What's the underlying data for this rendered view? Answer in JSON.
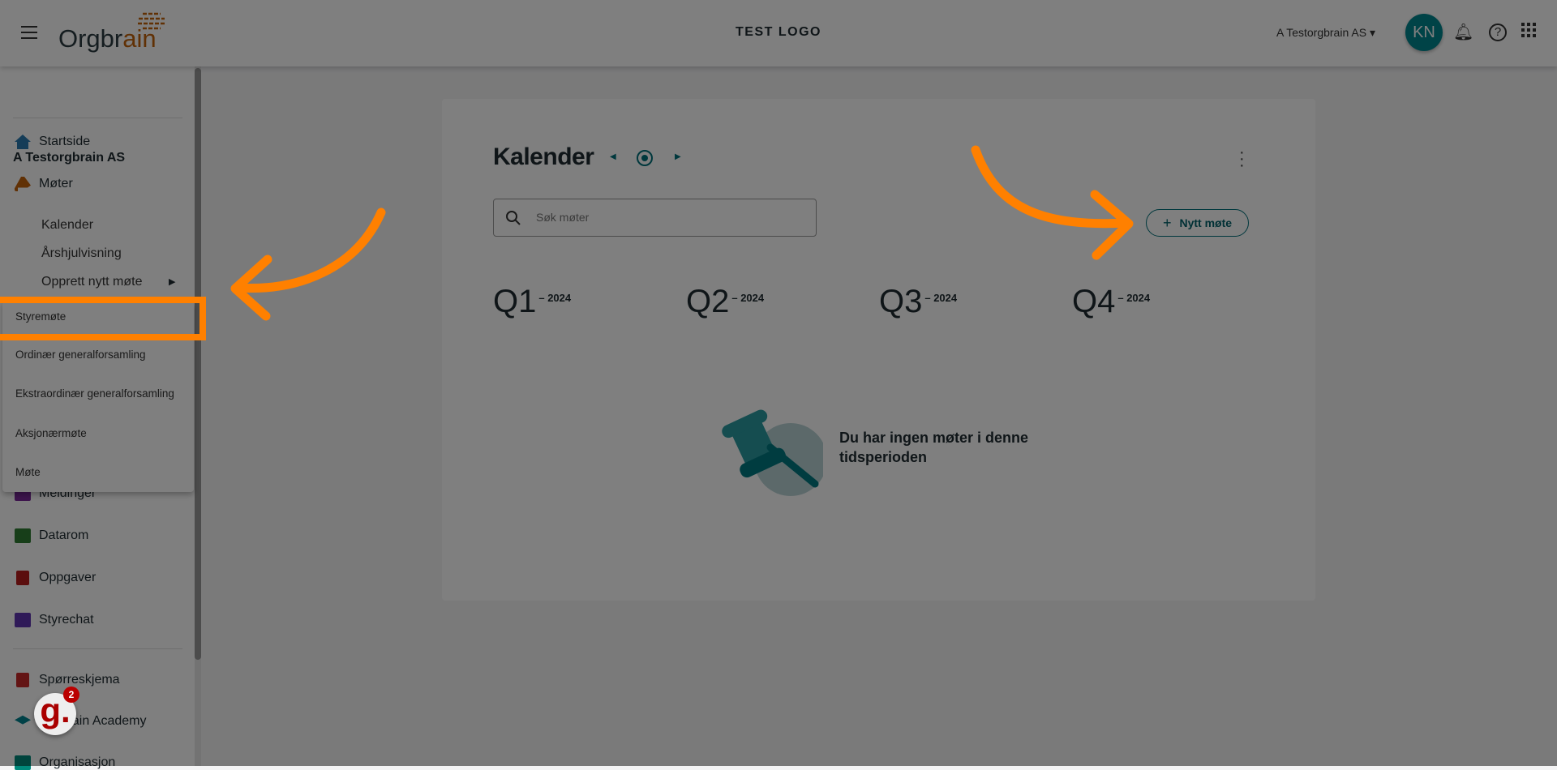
{
  "header": {
    "logo_text_a": "Orgbr",
    "logo_text_b": "ain",
    "center_logo": "TEST LOGO",
    "org_selector": "A Testorgbrain AS",
    "avatar_initials": "KN"
  },
  "sidebar": {
    "org": "A Testorgbrain AS",
    "items": [
      {
        "label": "Startside",
        "icon": "home-icon",
        "color": "#2a7bb0"
      },
      {
        "label": "Møter",
        "icon": "gavel-icon",
        "color": "#c2620a"
      }
    ],
    "sub_items": [
      "Kalender",
      "Årshjulvisning",
      "Opprett nytt møte"
    ],
    "items2": [
      {
        "label": "Meldinger",
        "color": "#7b2a9a"
      },
      {
        "label": "Datarom",
        "color": "#2e7d32"
      },
      {
        "label": "Oppgaver",
        "color": "#b71c1c"
      },
      {
        "label": "Styrechat",
        "color": "#5e35b1"
      },
      {
        "label": "Spørreskjema",
        "color": "#c62828"
      },
      {
        "label": "Orgbrain Academy",
        "color": "#00838f"
      },
      {
        "label": "Organisasjon",
        "color": "#00897b"
      }
    ]
  },
  "menu": {
    "items": [
      "Styremøte",
      "Ordinær generalforsamling",
      "Ekstraordinær generalforsamling",
      "Aksjonærmøte",
      "Møte"
    ]
  },
  "main": {
    "title": "Kalender",
    "search_placeholder": "Søk møter",
    "new_button": "Nytt møte",
    "quarters": [
      {
        "q": "Q1",
        "year": "– 2024"
      },
      {
        "q": "Q2",
        "year": "– 2024"
      },
      {
        "q": "Q3",
        "year": "– 2024"
      },
      {
        "q": "Q4",
        "year": "– 2024"
      }
    ],
    "empty_text": "Du har ingen møter i denne tidsperioden"
  },
  "chat": {
    "badge": "2",
    "glyph": "g."
  },
  "colors": {
    "accent": "#00868f",
    "annotation": "#ff8000"
  }
}
